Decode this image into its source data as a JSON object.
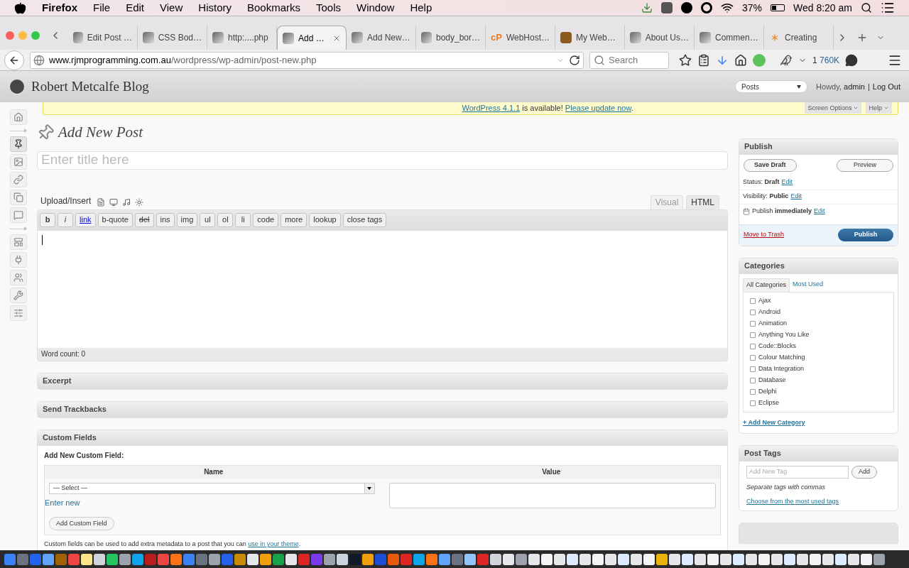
{
  "menubar": {
    "app": "Firefox",
    "menus": [
      "File",
      "Edit",
      "View",
      "History",
      "Bookmarks",
      "Tools",
      "Window",
      "Help"
    ],
    "battery": "37%",
    "clock": "Wed 8:20 am"
  },
  "tabs": [
    {
      "label": "Edit Post …",
      "selected": false,
      "kind": "generic"
    },
    {
      "label": "CSS Bod…",
      "selected": false,
      "kind": "generic"
    },
    {
      "label": "http:....php",
      "selected": false,
      "kind": "generic"
    },
    {
      "label": "Add …",
      "selected": true,
      "kind": "generic"
    },
    {
      "label": "Add New…",
      "selected": false,
      "kind": "generic"
    },
    {
      "label": "body_bor…",
      "selected": false,
      "kind": "generic"
    },
    {
      "label": "WebHost…",
      "selected": false,
      "kind": "text",
      "favicon_text": "cP"
    },
    {
      "label": "My Web…",
      "selected": false,
      "kind": "app"
    },
    {
      "label": "About Us…",
      "selected": false,
      "kind": "generic"
    },
    {
      "label": "Commen…",
      "selected": false,
      "kind": "generic"
    },
    {
      "label": "Creating",
      "selected": false,
      "kind": "asterisk"
    }
  ],
  "urlbar": {
    "host": "www.rjmprogramming.com.au",
    "path": "/wordpress/wp-admin/post-new.php",
    "search_placeholder": "Search",
    "count": "1",
    "size": "760K"
  },
  "wp_header": {
    "site_title": "Robert Metcalfe Blog",
    "favorites": "Posts",
    "howdy": "Howdy,",
    "user": "admin",
    "separator": "|",
    "logout": "Log Out"
  },
  "notice": {
    "link": "WordPress 4.1.1",
    "middle": " is available! ",
    "update_link": "Please update now",
    "end": ".",
    "screen_options": "Screen Options",
    "help": "Help"
  },
  "sidebar": {
    "items": [
      {
        "kind": "item",
        "selected": false
      },
      {
        "kind": "separator"
      },
      {
        "kind": "item",
        "selected": true
      },
      {
        "kind": "item",
        "selected": false
      },
      {
        "kind": "item",
        "selected": false
      },
      {
        "kind": "item",
        "selected": false
      },
      {
        "kind": "item",
        "selected": false
      },
      {
        "kind": "separator"
      },
      {
        "kind": "item",
        "selected": false
      },
      {
        "kind": "item",
        "selected": false
      },
      {
        "kind": "item",
        "selected": false
      },
      {
        "kind": "item",
        "selected": false
      },
      {
        "kind": "item",
        "selected": false
      }
    ]
  },
  "editor": {
    "page_title": "Add New Post",
    "title_placeholder": "Enter title here",
    "upload_label": "Upload/Insert",
    "tabs": [
      {
        "label": "Visual",
        "selected": false
      },
      {
        "label": "HTML",
        "selected": true
      }
    ],
    "quicktags": [
      {
        "label": "b",
        "kind": "bold"
      },
      {
        "label": "i",
        "kind": "italic"
      },
      {
        "label": "link",
        "kind": "link"
      },
      {
        "label": "b-quote",
        "kind": "plain"
      },
      {
        "label": "del",
        "kind": "strike"
      },
      {
        "label": "ins",
        "kind": "plain"
      },
      {
        "label": "img",
        "kind": "plain"
      },
      {
        "label": "ul",
        "kind": "plain"
      },
      {
        "label": "ol",
        "kind": "plain"
      },
      {
        "label": "li",
        "kind": "plain"
      },
      {
        "label": "code",
        "kind": "plain"
      },
      {
        "label": "more",
        "kind": "plain"
      },
      {
        "label": "lookup",
        "kind": "plain"
      },
      {
        "label": "close tags",
        "kind": "plain"
      }
    ],
    "word_count": "Word count: 0"
  },
  "collapsed_boxes": [
    "Excerpt",
    "Send Trackbacks"
  ],
  "custom_fields": {
    "title": "Custom Fields",
    "subtitle": "Add New Custom Field:",
    "columns": [
      "Name",
      "Value"
    ],
    "select": "— Select —",
    "enter_new": "Enter new",
    "button": "Add Custom Field",
    "note": "Custom fields can be used to add extra metadata to a post that you can ",
    "note_link": "use in your theme",
    "note_end": "."
  },
  "publish": {
    "title": "Publish",
    "save_draft": "Save Draft",
    "preview": "Preview",
    "rows": [
      {
        "kind": "text",
        "label": "Status:",
        "value": "Draft",
        "link": "Edit"
      },
      {
        "kind": "text",
        "label": "Visibility:",
        "value": "Public",
        "link": "Edit"
      },
      {
        "kind": "calendar",
        "label": "Publish",
        "value": "immediately",
        "link": "Edit"
      }
    ],
    "trash": "Move to Trash",
    "publish_button": "Publish"
  },
  "categories": {
    "title": "Categories",
    "tabs": [
      {
        "label": "All Categories",
        "selected": true
      },
      {
        "label": "Most Used",
        "selected": false
      }
    ],
    "items": [
      {
        "label": "Ajax",
        "checked": false
      },
      {
        "label": "Android",
        "checked": false
      },
      {
        "label": "Animation",
        "checked": false
      },
      {
        "label": "Anything You Like",
        "checked": false
      },
      {
        "label": "Code::Blocks",
        "checked": false
      },
      {
        "label": "Colour Matching",
        "checked": false
      },
      {
        "label": "Data Integration",
        "checked": false
      },
      {
        "label": "Database",
        "checked": false
      },
      {
        "label": "Delphi",
        "checked": false
      },
      {
        "label": "Eclipse",
        "checked": false
      }
    ],
    "add_new": "+ Add New Category"
  },
  "post_tags": {
    "title": "Post Tags",
    "placeholder": "Add New Tag",
    "button": "Add",
    "hint": "Separate tags with commas",
    "link": "Choose from the most used tags"
  }
}
